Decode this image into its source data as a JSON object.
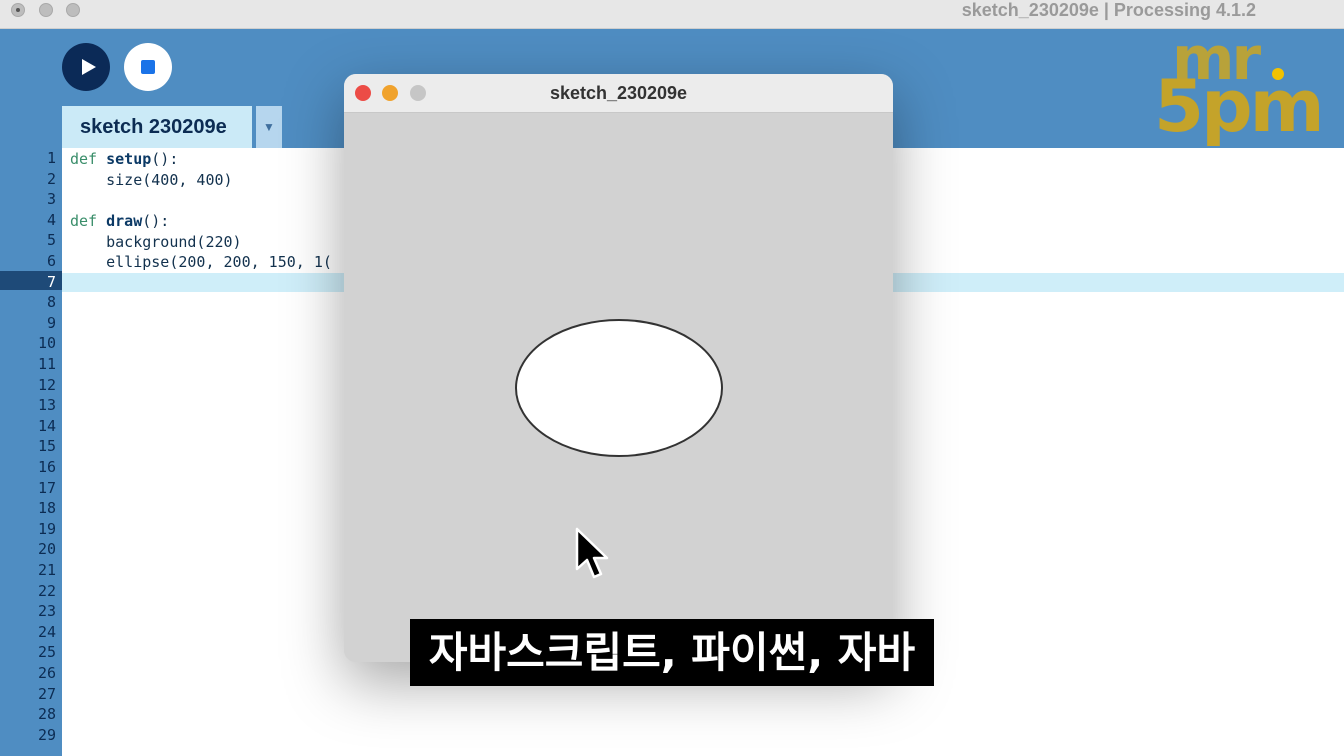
{
  "app": {
    "window_title": "sketch_230209e | Processing 4.1.2"
  },
  "toolbar": {
    "tab_label": "sketch 230209e",
    "tab_menu_icon": "▼"
  },
  "logo": {
    "line1": "mr",
    "line2": "5pm"
  },
  "editor": {
    "line_numbers": [
      "1",
      "2",
      "3",
      "4",
      "5",
      "6",
      "7",
      "8",
      "9",
      "10",
      "11",
      "12",
      "13",
      "14",
      "15",
      "16",
      "17",
      "18",
      "19",
      "20",
      "21",
      "22",
      "23",
      "24",
      "25",
      "26",
      "27",
      "28",
      "29"
    ],
    "lines": [
      {
        "kw": "def",
        "fn": "setup",
        "rest": "():"
      },
      {
        "text": "    size(400, 400)"
      },
      {
        "text": ""
      },
      {
        "kw": "def",
        "fn": "draw",
        "rest": "():"
      },
      {
        "text": "    background(220)"
      },
      {
        "text": "    ellipse(200, 200, 150, 1("
      }
    ],
    "current_line": "7"
  },
  "sketch_window": {
    "title": "sketch_230209e",
    "background_color": "#d2d2d2",
    "ellipse_fill": "#ffffff"
  },
  "subtitle": {
    "text": "자바스크립트, 파이썬, 자바"
  },
  "colors": {
    "toolbar": "#4f8dc2",
    "run_button": "#0b2a57",
    "stop_icon": "#1a73e8",
    "tab": "#cbeaf7",
    "highlight": "#cfeef9"
  }
}
